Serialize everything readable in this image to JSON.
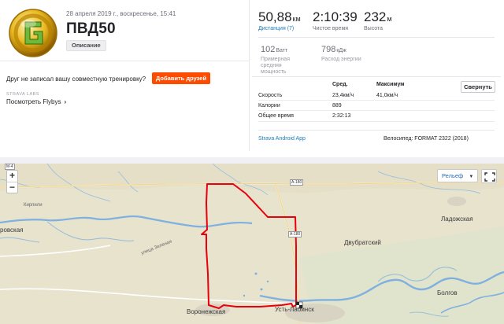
{
  "activity": {
    "date_line": "28 апреля 2019 г., воскресенье, 15:41",
    "title": "ПВД50",
    "description_button": "Описание"
  },
  "social": {
    "friend_question": "Друг не записал вашу совместную тренировку?",
    "add_friends_button": "Добавить друзей",
    "labs_label": "STRAVA LABS",
    "flybys_link": "Посмотреть Flybys"
  },
  "stats": {
    "distance": {
      "value": "50,88",
      "unit": "км",
      "label": "Дистанция (7)"
    },
    "moving_time": {
      "value": "2:10:39",
      "label": "Чистое время"
    },
    "elevation": {
      "value": "232",
      "unit": "м",
      "label": "Высота"
    },
    "power": {
      "value": "102",
      "unit": "Ватт",
      "label": "Примерная средняя мощность"
    },
    "energy": {
      "value": "798",
      "unit": "кДж",
      "label": "Расход энергии"
    }
  },
  "details": {
    "col_avg": "Сред.",
    "col_max": "Максимум",
    "collapse_button": "Свернуть",
    "rows": [
      {
        "label": "Скорость",
        "avg": "23,4км/ч",
        "max": "41,0км/ч"
      },
      {
        "label": "Калории",
        "avg": "889",
        "max": ""
      },
      {
        "label": "Общее время",
        "avg": "2:32:13",
        "max": ""
      }
    ],
    "device": "Strava Android App",
    "bike": "Велосипед: FORMAT 2322 (2018)"
  },
  "map": {
    "zoom_in": "+",
    "zoom_out": "−",
    "layer_button": "Рельеф",
    "road_labels": [
      "М-4",
      "А-180",
      "А-180"
    ],
    "places": [
      "Ладожская",
      "Двубратский",
      "Болгов",
      "Воронежская",
      "Усть-Лабинск",
      "ровская",
      "Кирпили",
      "улица Зеленая"
    ],
    "route_color": "#e8000c",
    "river_color": "#7fb0e0"
  },
  "colors": {
    "accent": "#fc4c02",
    "link": "#1e7ab8"
  }
}
